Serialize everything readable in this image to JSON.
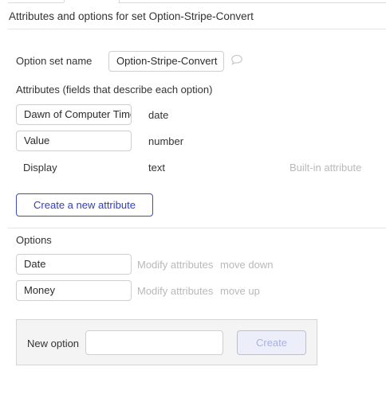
{
  "page": {
    "title": "Attributes and options for set Option-Stripe-Convert"
  },
  "option_set": {
    "name_label": "Option set name",
    "name_value": "Option-Stripe-Convert"
  },
  "attributes": {
    "heading": "Attributes (fields that describe each option)",
    "items": [
      {
        "name": "Dawn of Computer Time",
        "type": "date",
        "note": ""
      },
      {
        "name": "Value",
        "type": "number",
        "note": ""
      },
      {
        "name": "Display",
        "type": "text",
        "note": "Built-in attribute"
      }
    ],
    "create_button": "Create a new attribute"
  },
  "options": {
    "heading": "Options",
    "items": [
      {
        "name": "Date",
        "modify": "Modify attributes",
        "move": "move down"
      },
      {
        "name": "Money",
        "modify": "Modify attributes",
        "move": "move up"
      }
    ]
  },
  "new_option": {
    "label": "New option",
    "input_value": "",
    "create_button": "Create"
  },
  "colors": {
    "accent": "#3b4ad3",
    "muted_text": "#b9b9b9",
    "panel_bg": "#f4f4f4"
  },
  "icons": {
    "comment": "comment-icon"
  }
}
